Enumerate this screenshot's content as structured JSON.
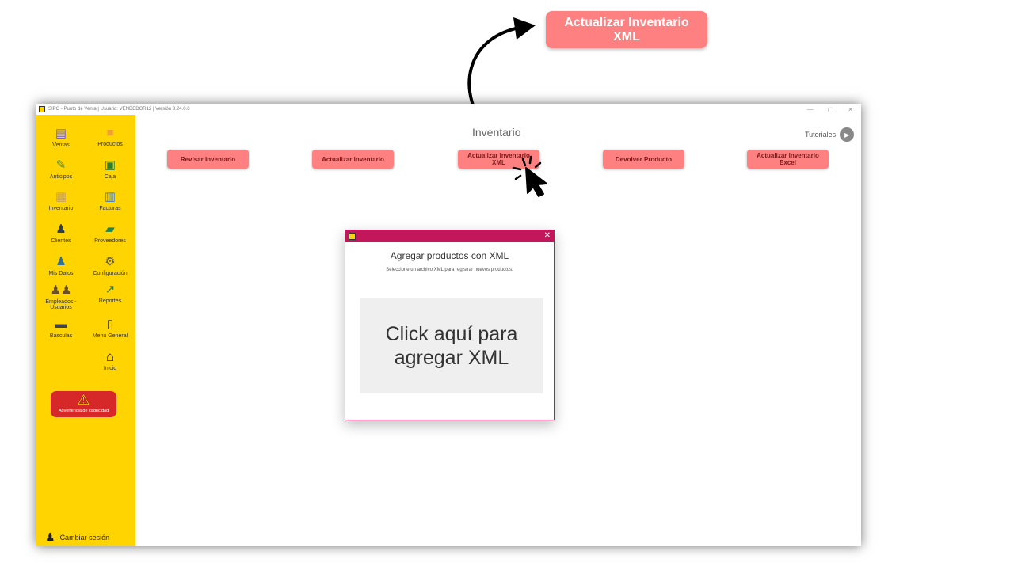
{
  "callout": {
    "label": "Actualizar Inventario\nXML"
  },
  "window": {
    "title": "SIPO - Punto de Venta   |  Usuario: VENDEDOR12 | Versión 3.24.0.0",
    "controls": [
      "—",
      "▢",
      "✕"
    ]
  },
  "sidebar": {
    "items": [
      {
        "label": "Ventas",
        "icon": "cash-register-icon"
      },
      {
        "label": "Productos",
        "icon": "box-icon"
      },
      {
        "label": "Anticipos",
        "icon": "money-hand-icon"
      },
      {
        "label": "Caja",
        "icon": "cash-icon"
      },
      {
        "label": "Inventario",
        "icon": "boxes-icon"
      },
      {
        "label": "Facturas",
        "icon": "invoice-icon"
      },
      {
        "label": "Clientes",
        "icon": "client-icon"
      },
      {
        "label": "Proveedores",
        "icon": "truck-icon"
      },
      {
        "label": "Mis Datos",
        "icon": "user-icon"
      },
      {
        "label": "Configuración",
        "icon": "gear-icon"
      },
      {
        "label": "Empleados - Usuarios",
        "icon": "users-icon"
      },
      {
        "label": "Reportes",
        "icon": "chart-icon"
      },
      {
        "label": "Básculas",
        "icon": "scale-icon"
      },
      {
        "label": "Menú General",
        "icon": "clipboard-icon"
      },
      {
        "label": "Inicio",
        "icon": "home-icon"
      }
    ],
    "warning": "Advertencia de caducidad",
    "switch_session": "Cambiar sesión"
  },
  "content": {
    "title": "Inventario",
    "tutorials": "Tutoriales",
    "buttons": [
      "Revisar Inventario",
      "Actualizar Inventario",
      "Actualizar Inventario\nXML",
      "Devolver Producto",
      "Actualizar Inventario\nExcel"
    ]
  },
  "dialog": {
    "title": "Agregar productos con XML",
    "subtitle": "Seleccione un archivo XML para registrar nuevos productos.",
    "drop_zone": "Click aquí para\nagregar XML",
    "close": "✕"
  },
  "colors": {
    "sidebar": "#ffd400",
    "action_button": "#ff8080",
    "dialog_accent": "#c2185b",
    "warning": "#d62828"
  }
}
